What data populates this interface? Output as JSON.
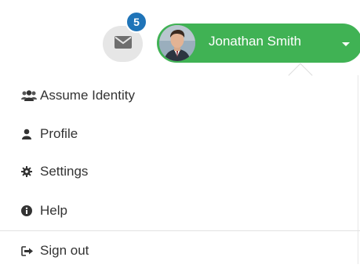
{
  "header": {
    "mail_badge_count": "5",
    "user_name": "Jonathan Smith"
  },
  "menu": {
    "items": [
      {
        "label": "Assume Identity",
        "icon": "users-icon"
      },
      {
        "label": "Profile",
        "icon": "user-icon"
      },
      {
        "label": "Settings",
        "icon": "gear-icon"
      },
      {
        "label": "Help",
        "icon": "info-circle-icon"
      },
      {
        "label": "Sign out",
        "icon": "sign-out-icon"
      }
    ]
  },
  "colors": {
    "user_button": "#40b254",
    "badge": "#1f74b8",
    "mail_button_bg": "#e6e6e6"
  }
}
